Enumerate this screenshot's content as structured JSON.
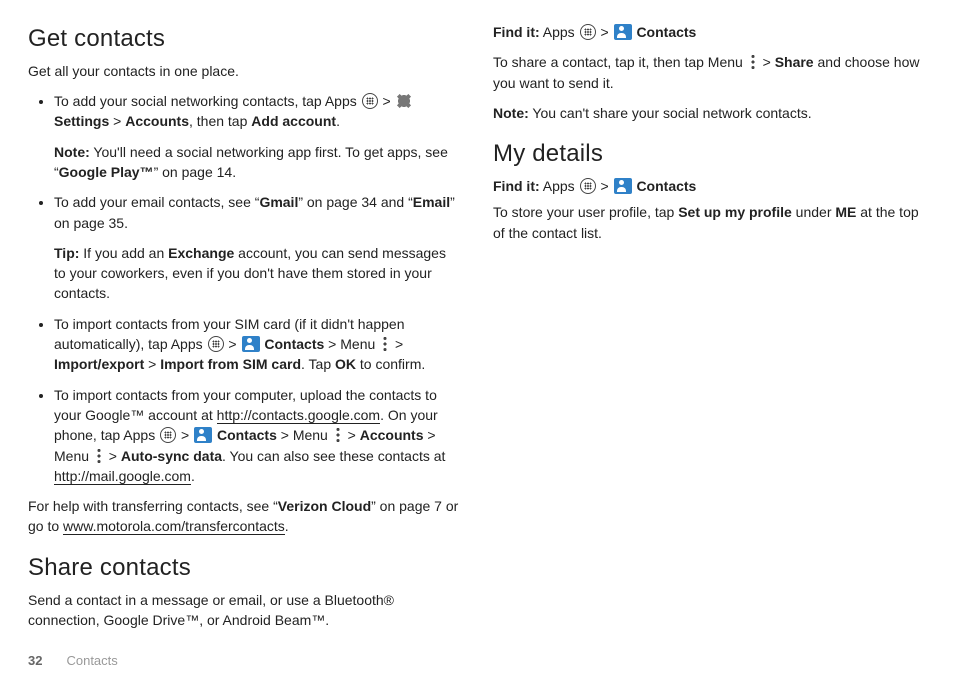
{
  "left": {
    "h1a": "Get contacts",
    "intro_a": "Get all your contacts in one place.",
    "li1_pre": "To add your social networking contacts, tap Apps ",
    "li1_gt": " > ",
    "li1_settings": "Settings",
    "li1_gt2": " > ",
    "li1_accounts": "Accounts",
    "li1_then": ", then tap ",
    "li1_add": "Add account",
    "li1_period": ".",
    "li1_note_lbl": "Note:",
    "li1_note_pre": " You'll need a social networking app first. To get apps, see “",
    "li1_note_link": "Google Play™",
    "li1_note_post": "” on page 14.",
    "li2_pre": "To add your email contacts, see “",
    "li2_gmail": "Gmail",
    "li2_mid": "” on page 34 and “",
    "li2_email": "Email",
    "li2_post": "” on page 35.",
    "li2_tip_lbl": "Tip:",
    "li2_tip_pre": " If you add an ",
    "li2_tip_exch": "Exchange",
    "li2_tip_post": " account, you can send messages to your coworkers, even if you don't have them stored in your contacts.",
    "li3_pre": "To import contacts from your SIM card (if it didn't happen automatically), tap Apps ",
    "li3_gt": " > ",
    "li3_contacts": "Contacts",
    "li3_gt2": " > Menu ",
    "li3_gt3": " > ",
    "li3_imp": "Import/export",
    "li3_gt4": " > ",
    "li3_impsim": "Import from SIM card",
    "li3_tap": ". Tap ",
    "li3_ok": "OK",
    "li3_conf": " to confirm.",
    "li4_pre": "To import contacts from your computer, upload the contacts to your Google™ account at ",
    "li4_url1": "http://contacts.google.com",
    "li4_mid1": ". On your phone, tap Apps ",
    "li4_gt": " > ",
    "li4_contacts": "Contacts",
    "li4_menu": " > Menu ",
    "li4_gt2": " > ",
    "li4_acc": "Accounts",
    "li4_menu2": " > Menu ",
    "li4_gt3": " > ",
    "li4_sync": "Auto-sync data",
    "li4_mid2": ". You can also see these contacts at ",
    "li4_url2": "http://mail.google.com",
    "li4_period": ".",
    "help_pre": "For help with transferring contacts, see “",
    "help_vz": "Verizon Cloud",
    "help_mid": "” on page 7 or go to ",
    "help_url": "www.motorola.com/transfercontacts",
    "help_period": ".",
    "h1b": "Share contacts",
    "intro_b": "Send a contact in a message or email, or use a Bluetooth® connection, Google Drive™, or Android Beam™."
  },
  "right": {
    "find_lbl": "Find it:",
    "find_apps": " Apps ",
    "find_gt": " > ",
    "find_contacts": "Contacts",
    "share_pre": "To share a contact, tap it, then tap Menu ",
    "share_gt": " > ",
    "share_bold": "Share",
    "share_post": " and choose how you want to send it.",
    "note_lbl": "Note:",
    "note_txt": " You can't share your social network contacts.",
    "h1c": "My details",
    "detail_pre": "To store your user profile, tap ",
    "detail_setup": "Set up my profile",
    "detail_mid": " under ",
    "detail_me": "ME",
    "detail_post": " at the top of the contact list."
  },
  "footer": {
    "page": "32",
    "section": "Contacts"
  }
}
